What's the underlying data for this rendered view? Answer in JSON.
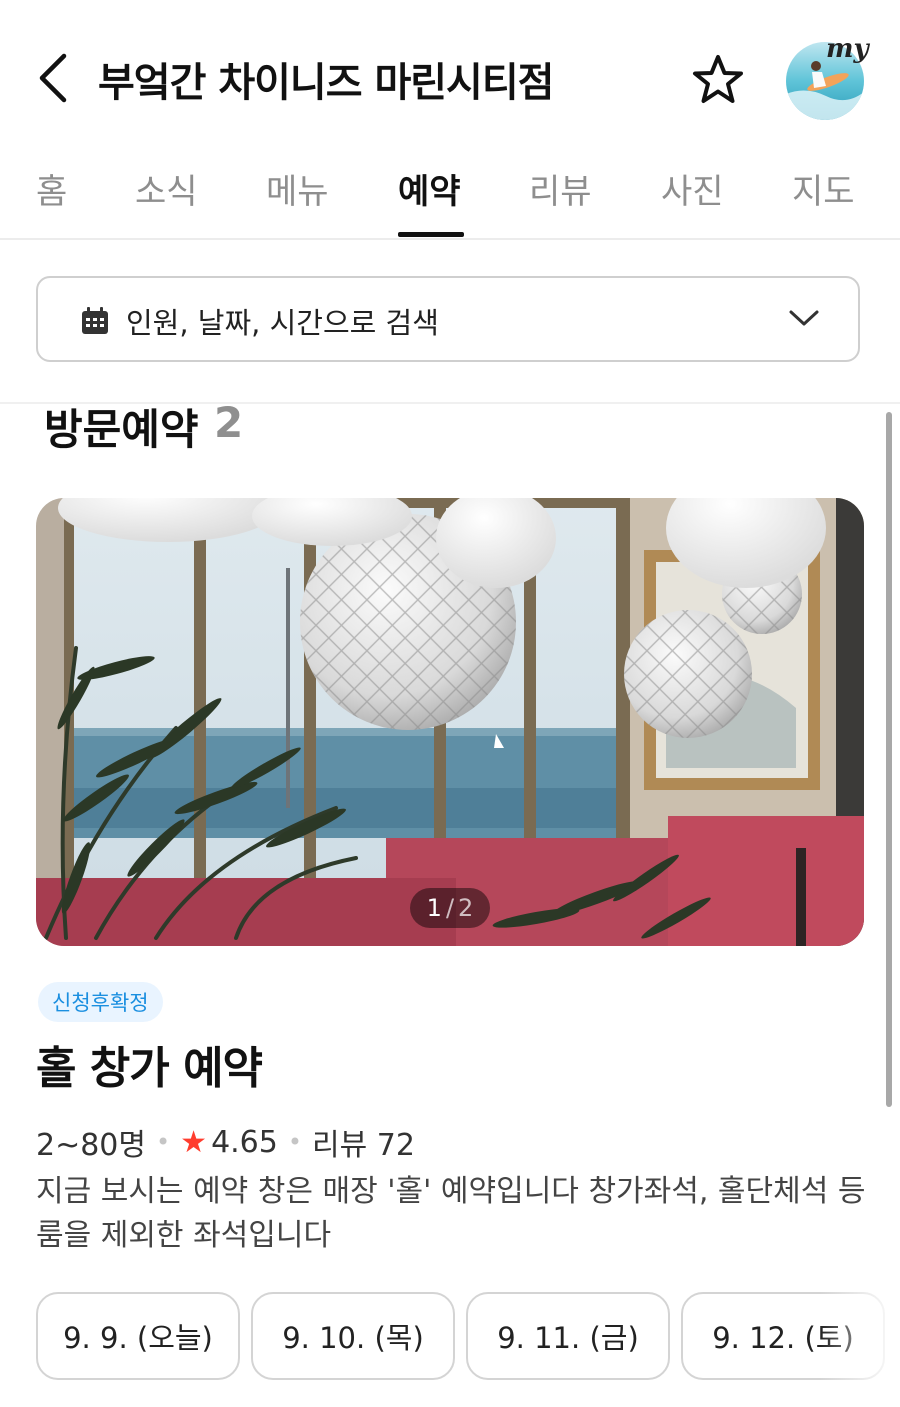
{
  "header": {
    "title": "부엌간 차이니즈 마린시티점",
    "avatar_label": "my",
    "icons": {
      "back": "back-arrow-icon",
      "favorite": "star-outline-icon"
    }
  },
  "tabs": [
    {
      "label": "홈",
      "active": false
    },
    {
      "label": "소식",
      "active": false
    },
    {
      "label": "메뉴",
      "active": false
    },
    {
      "label": "예약",
      "active": true
    },
    {
      "label": "리뷰",
      "active": false
    },
    {
      "label": "사진",
      "active": false
    },
    {
      "label": "지도",
      "active": false
    }
  ],
  "search": {
    "placeholder": "인원, 날짜, 시간으로 검색",
    "icon": "calendar-icon"
  },
  "section": {
    "title": "방문예약",
    "count": "2"
  },
  "product": {
    "pager_current": "1",
    "pager_total": "2",
    "badge": "신청후확정",
    "title": "홀 창가 예약",
    "capacity": "2~80명",
    "rating": "4.65",
    "reviews": "리뷰 72",
    "description": "지금 보시는 예약 창은 매장 '홀' 예약입니다 창가좌석, 홀단체석 등 룸을 제외한 좌석입니다"
  },
  "dates": [
    {
      "label": "9. 9. (오늘)"
    },
    {
      "label": "9. 10. (목)"
    },
    {
      "label": "9. 11. (금)"
    },
    {
      "label": "9. 12. (토)"
    }
  ],
  "colors": {
    "accent_text": "#111111",
    "tab_inactive": "#8e8e8e",
    "badge_bg": "#e9f4ff",
    "badge_text": "#1b8fe0",
    "rating_star": "#ff3d2e"
  }
}
